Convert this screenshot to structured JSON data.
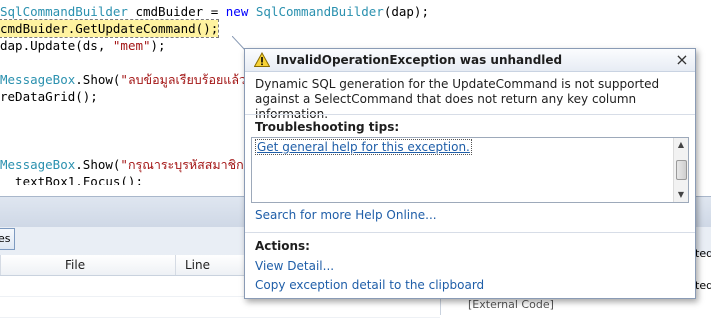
{
  "editor": {
    "lines": [
      [
        {
          "t": "SqlCommandBuilder",
          "c": "typ"
        },
        {
          "t": " cmdBuider = ",
          "c": ""
        },
        {
          "t": "new",
          "c": "kw"
        },
        {
          "t": " ",
          "c": ""
        },
        {
          "t": "SqlCommandBuilder",
          "c": "typ"
        },
        {
          "t": "(dap);",
          "c": ""
        }
      ],
      [
        {
          "t": "cmdBuider.GetUpdateCommand();",
          "c": ""
        }
      ],
      [
        {
          "t": "dap.Update(ds, ",
          "c": ""
        },
        {
          "t": "\"mem\"",
          "c": "str"
        },
        {
          "t": ");",
          "c": ""
        }
      ],
      [
        {
          "t": "",
          "c": ""
        }
      ],
      [
        {
          "t": "MessageBox",
          "c": "typ"
        },
        {
          "t": ".Show(",
          "c": ""
        },
        {
          "t": "\"ลบข้อมูลเรียบร้อยแล้ว\"",
          "c": "str"
        }
      ],
      [
        {
          "t": "reDataGrid();",
          "c": ""
        }
      ],
      [
        {
          "t": "",
          "c": ""
        }
      ],
      [
        {
          "t": "",
          "c": ""
        }
      ],
      [
        {
          "t": "",
          "c": ""
        }
      ],
      [
        {
          "t": "MessageBox",
          "c": "typ"
        },
        {
          "t": ".Show(",
          "c": ""
        },
        {
          "t": "\"กรุณาระบุรหัสสมาชิก\"",
          "c": "str"
        }
      ],
      [
        {
          "t": "  textBox1.Focus();",
          "c": ""
        }
      ]
    ]
  },
  "bottom_panel": {
    "tab_label": "es",
    "columns": [
      "File",
      "Line"
    ],
    "right_pane_rows": [
      "cted",
      "cted"
    ],
    "external_code": "[External Code]"
  },
  "exception_popup": {
    "title": "InvalidOperationException was unhandled",
    "message": "Dynamic SQL generation for the UpdateCommand is not supported against a SelectCommand that does not return any key column information.",
    "tips_heading": "Troubleshooting tips:",
    "tip_link": "Get general help for this exception.",
    "search_link": "Search for more Help Online...",
    "actions_heading": "Actions:",
    "view_detail": "View Detail...",
    "copy_detail": "Copy exception detail to the clipboard",
    "close_glyph": "×"
  },
  "colors": {
    "keyword": "#0000ff",
    "type": "#2b91af",
    "string": "#a31515",
    "link": "#1f5ea8",
    "highlight": "#fff3a0"
  }
}
